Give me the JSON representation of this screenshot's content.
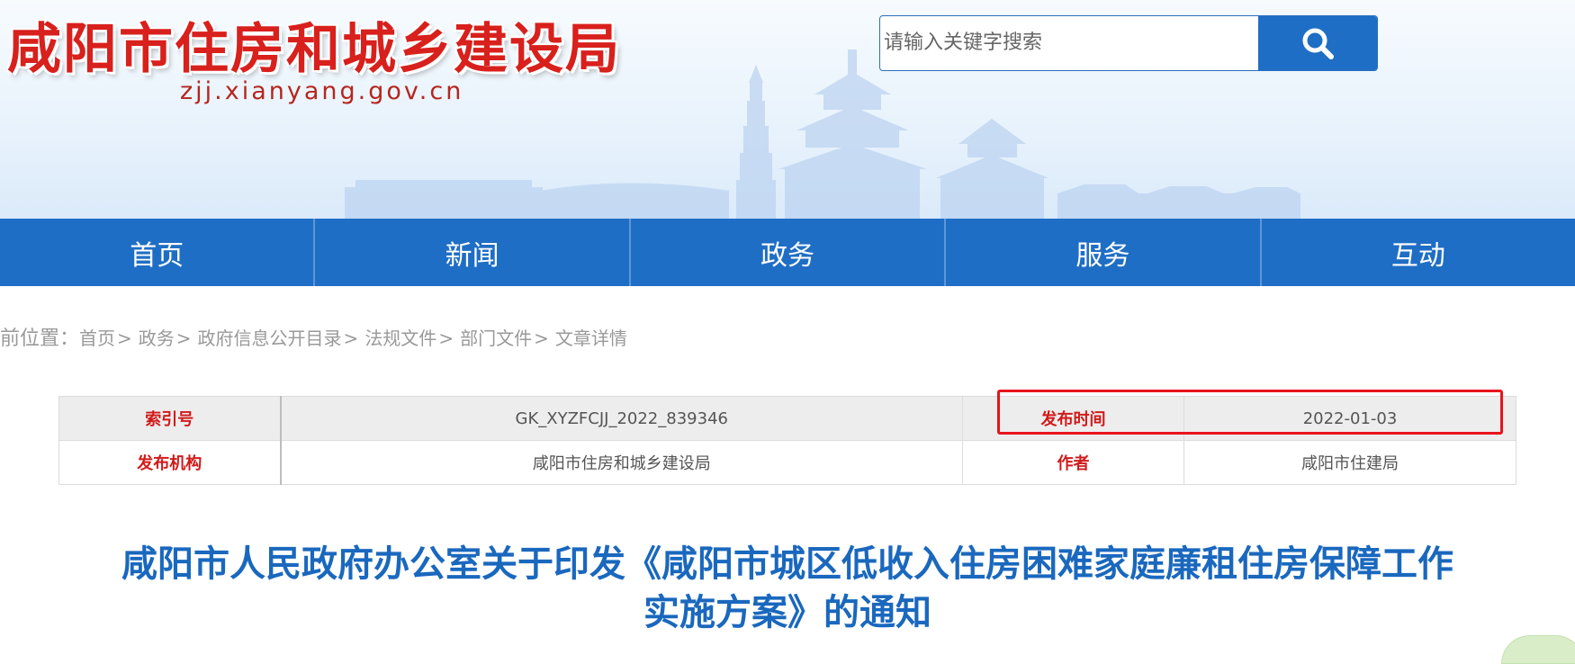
{
  "header": {
    "site_title": "咸阳市住房和城乡建设局",
    "site_domain": "zjj.xianyang.gov.cn",
    "search": {
      "placeholder": "请输入关键字搜索",
      "button_icon": "search-icon"
    }
  },
  "nav": {
    "items": [
      {
        "label": "首页"
      },
      {
        "label": "新闻"
      },
      {
        "label": "政务"
      },
      {
        "label": "服务"
      },
      {
        "label": "互动"
      }
    ]
  },
  "breadcrumb": {
    "prefix": "前位置：",
    "items": [
      {
        "label": "首页"
      },
      {
        "label": "政务"
      },
      {
        "label": "政府信息公开目录"
      },
      {
        "label": "法规文件"
      },
      {
        "label": "部门文件"
      },
      {
        "label": "文章详情"
      }
    ],
    "separator": ">"
  },
  "info": {
    "index_label": "索引号",
    "index_value": "GK_XYZFCJJ_2022_839346",
    "publish_time_label": "发布时间",
    "publish_time_value": "2022-01-03",
    "publisher_label": "发布机构",
    "publisher_value": "咸阳市住房和城乡建设局",
    "author_label": "作者",
    "author_value": "咸阳市住建局"
  },
  "article": {
    "title_line1": "咸阳市人民政府办公室关于印发《咸阳市城区低收入住房困难家庭廉租住房保障工作",
    "title_line2": "实施方案》的通知"
  },
  "colors": {
    "brand_blue": "#1f6ec5",
    "title_red": "#d8201c",
    "label_red": "#d11a1a",
    "highlight_red": "#e8141c"
  }
}
